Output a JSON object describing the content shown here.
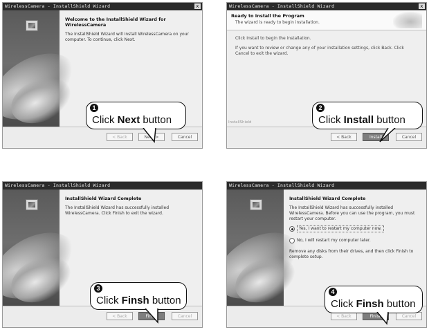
{
  "panels": [
    {
      "title": "WirelessCamera - InstallShield Wizard",
      "close": "x",
      "heading": "Welcome to the InstallShield Wizard for WirelessCamera",
      "body": "The InstallShield Wizard will install WirelessCamera on your computer.  To continue, click Next.",
      "buttons": {
        "back": "< Back",
        "next": "Next >",
        "cancel": "Cancel"
      },
      "callout": {
        "num": "1",
        "pre": "Click ",
        "bold": "Next",
        "post": " button"
      }
    },
    {
      "title": "WirelessCamera - InstallShield Wizard",
      "close": "x",
      "heading": "Ready to Install the Program",
      "subheading": "The wizard is ready to begin installation.",
      "body1": "Click Install to begin the installation.",
      "body2": "If you want to review or change any of your installation settings, click Back. Click Cancel to exit the wizard.",
      "footer_brand": "InstallShield",
      "buttons": {
        "back": "< Back",
        "install": "Install",
        "cancel": "Cancel"
      },
      "callout": {
        "num": "2",
        "pre": "Click ",
        "bold": "Install",
        "post": " button"
      }
    },
    {
      "title": "WirelessCamera - InstallShield Wizard",
      "heading": "InstallShield Wizard Complete",
      "body": "The InstallShield Wizard has successfully installed WirelessCamera.  Click Finish to exit the wizard.",
      "buttons": {
        "back": "< Back",
        "finish": "Finish",
        "cancel": "Cancel"
      },
      "callout": {
        "num": "3",
        "pre": "Click ",
        "bold": "Finsh",
        "post": " button"
      }
    },
    {
      "title": "WirelessCamera - InstallShield Wizard",
      "heading": "InstallShield Wizard Complete",
      "body": "The InstallShield Wizard has successfully installed WirelessCamera.  Before you can use the program, you must restart your computer.",
      "radio_yes": "Yes, I want to restart my computer now.",
      "radio_no": "No, I will restart my computer later.",
      "body2": "Remove any disks from their drives, and then click Finish to complete setup.",
      "buttons": {
        "back": "< Back",
        "finish": "Finish",
        "cancel": "Cancel"
      },
      "callout": {
        "num": "4",
        "pre": "Click ",
        "bold": "Finsh",
        "post": " button"
      }
    }
  ]
}
